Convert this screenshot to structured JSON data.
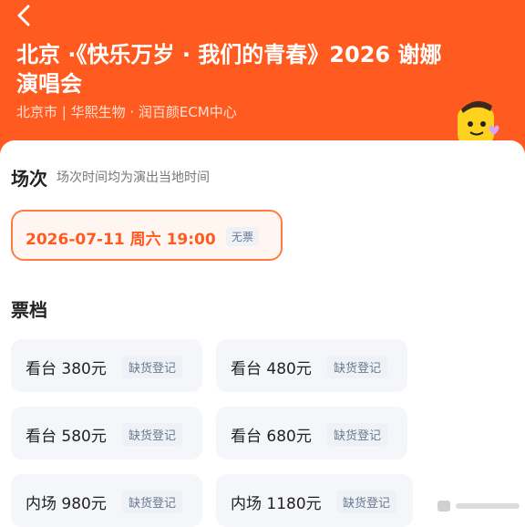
{
  "header": {
    "title": "北京 ·《快乐万岁 · 我们的青春》2026 谢娜演唱会",
    "venue": "北京市 | 华熙生物 · 润百颜ECM中心",
    "background_color": "#ff5a1f"
  },
  "session": {
    "section_title": "场次",
    "note": "场次时间均为演出当地时间",
    "date_label": "2026-07-11 周六 19:00",
    "status": "无票"
  },
  "tickets": {
    "section_title": "票档",
    "items": [
      {
        "label": "看台 380元",
        "status": "缺货登记"
      },
      {
        "label": "看台 480元",
        "status": "缺货登记"
      },
      {
        "label": "看台 580元",
        "status": "缺货登记"
      },
      {
        "label": "看台 680元",
        "status": "缺货登记"
      },
      {
        "label": "内场 980元",
        "status": "缺货登记"
      },
      {
        "label": "内场 1180元",
        "status": "缺货登记"
      }
    ]
  }
}
